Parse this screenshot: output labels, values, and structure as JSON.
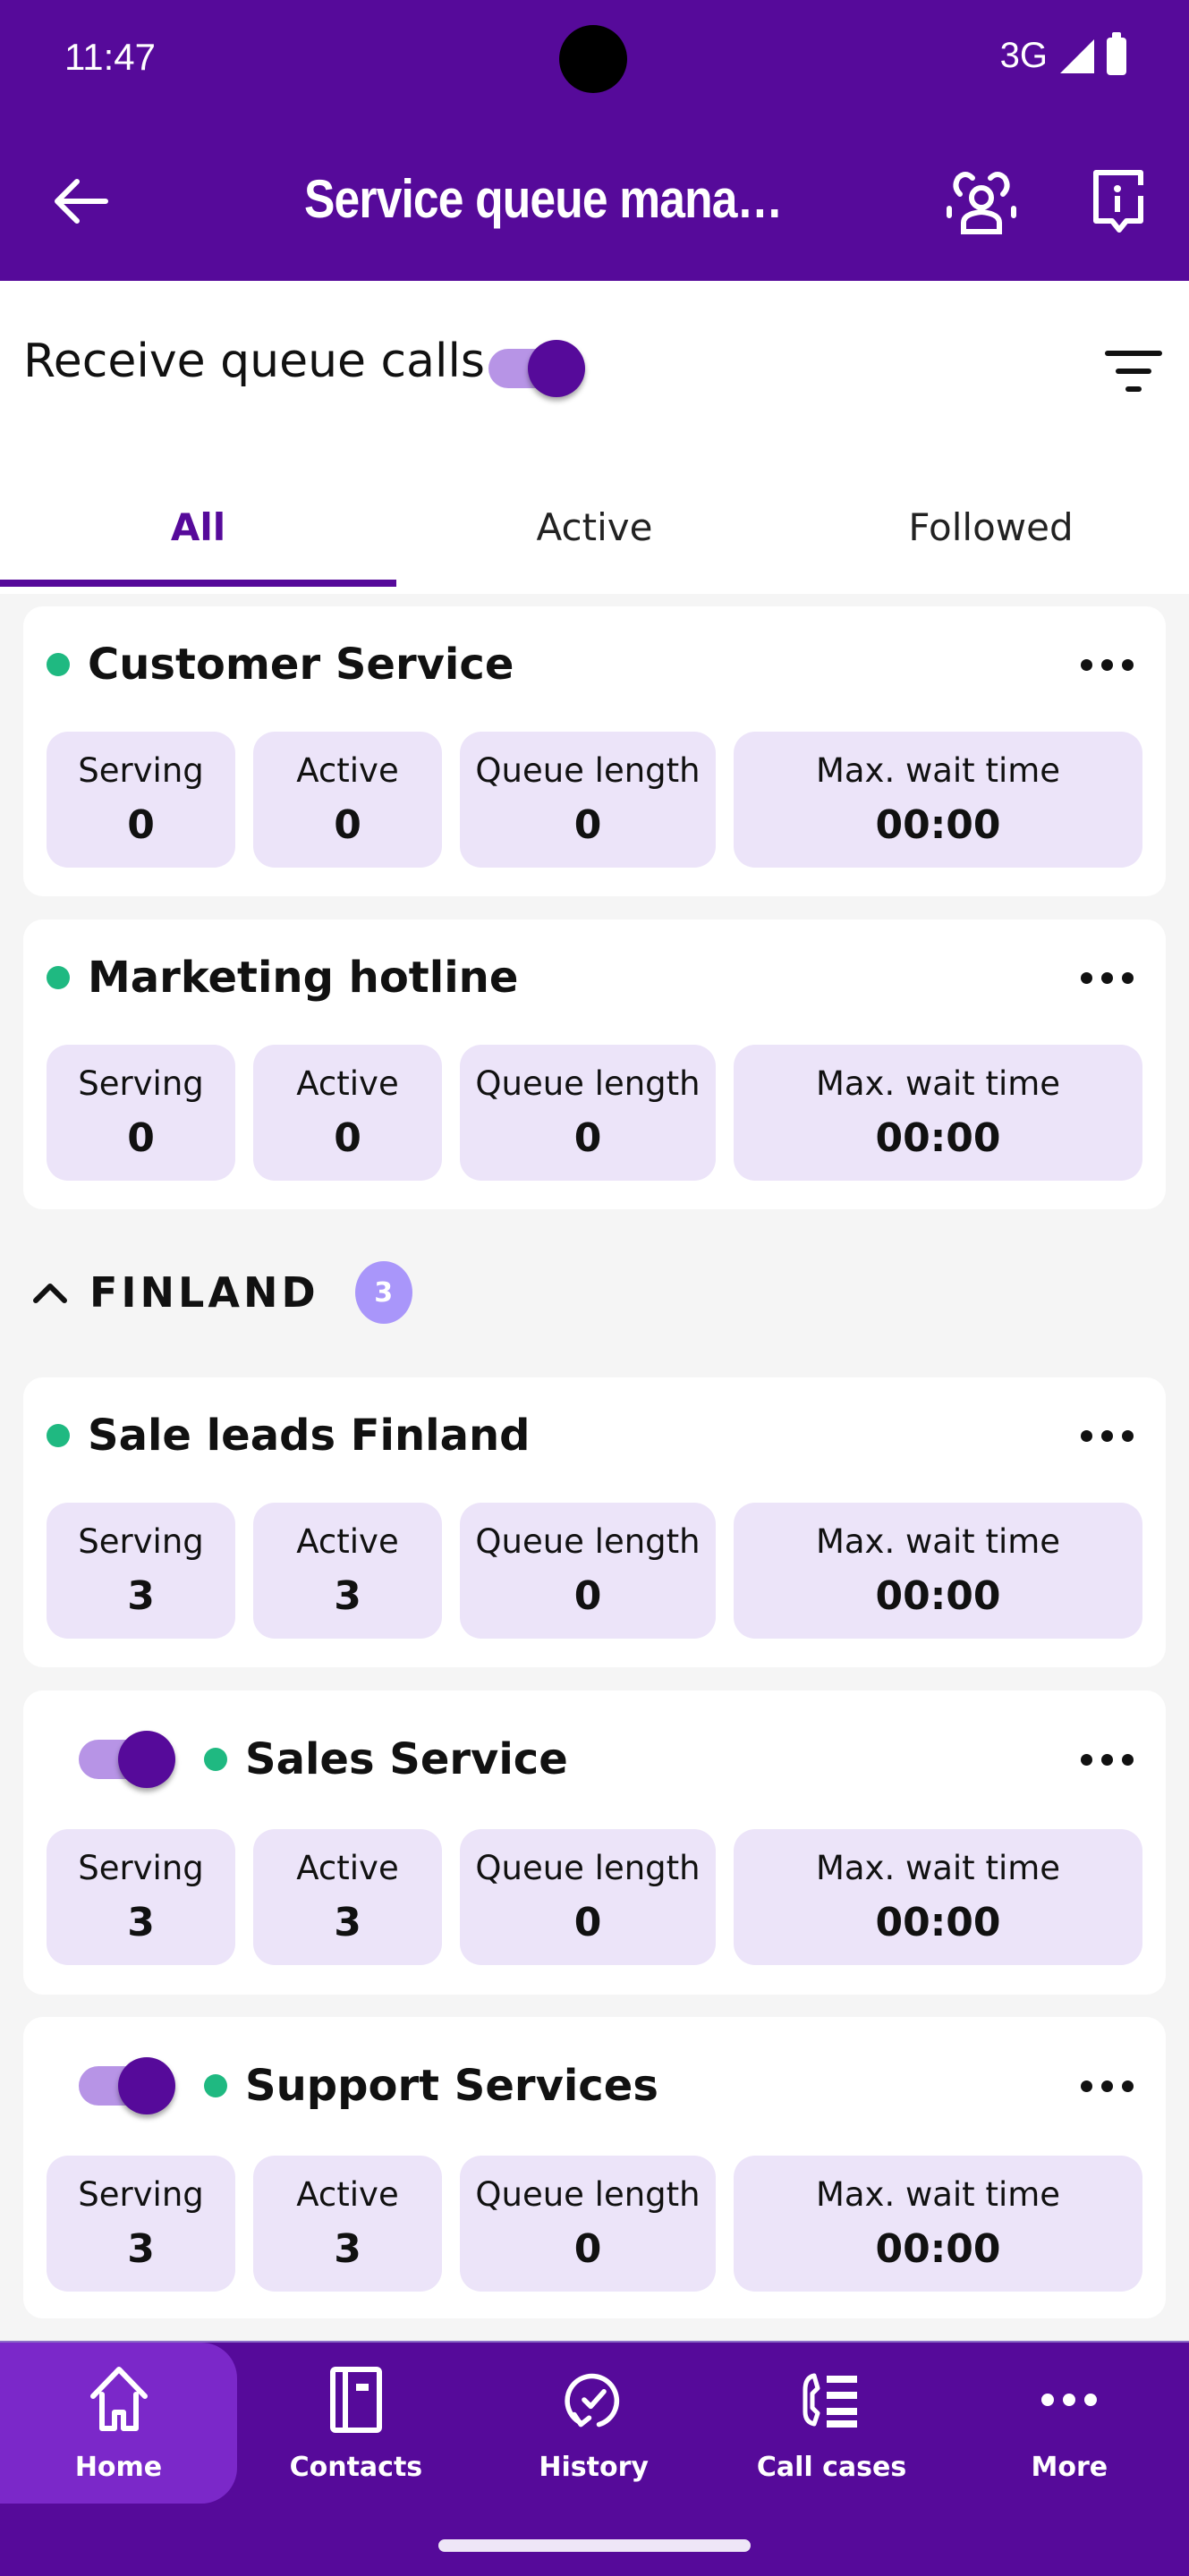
{
  "status_bar": {
    "time": "11:47",
    "network": "3G"
  },
  "header": {
    "title": "Service queue manage…"
  },
  "controls": {
    "receive_label": "Receive queue calls",
    "receive_on": true
  },
  "tabs": [
    {
      "label": "All",
      "active": true
    },
    {
      "label": "Active",
      "active": false
    },
    {
      "label": "Followed",
      "active": false
    }
  ],
  "metric_labels": [
    "Serving",
    "Active",
    "Queue length",
    "Max. wait time"
  ],
  "cards": [
    {
      "name": "Customer Service",
      "has_toggle": false,
      "values": [
        "0",
        "0",
        "0",
        "00:00"
      ]
    },
    {
      "name": "Marketing hotline",
      "has_toggle": false,
      "values": [
        "0",
        "0",
        "0",
        "00:00"
      ]
    },
    {
      "name": "Sale leads Finland",
      "has_toggle": false,
      "values": [
        "3",
        "3",
        "0",
        "00:00"
      ]
    },
    {
      "name": "Sales Service",
      "has_toggle": true,
      "toggle_on": true,
      "values": [
        "3",
        "3",
        "0",
        "00:00"
      ]
    },
    {
      "name": "Support Services",
      "has_toggle": true,
      "toggle_on": true,
      "values": [
        "3",
        "3",
        "0",
        "00:00"
      ]
    }
  ],
  "group": {
    "title": "FINLAND",
    "count": "3",
    "expanded": true
  },
  "bottom_nav": [
    {
      "label": "Home",
      "icon": "home-icon",
      "active": true
    },
    {
      "label": "Contacts",
      "icon": "contacts-icon",
      "active": false
    },
    {
      "label": "History",
      "icon": "history-icon",
      "active": false
    },
    {
      "label": "Call cases",
      "icon": "call-cases-icon",
      "active": false
    },
    {
      "label": "More",
      "icon": "more-icon",
      "active": false
    }
  ],
  "colors": {
    "brand": "#560a9a",
    "status_ok": "#1fb981",
    "metric_bg": "#ece4f9",
    "badge": "#a996fa",
    "nav_active": "#7b28c9"
  }
}
